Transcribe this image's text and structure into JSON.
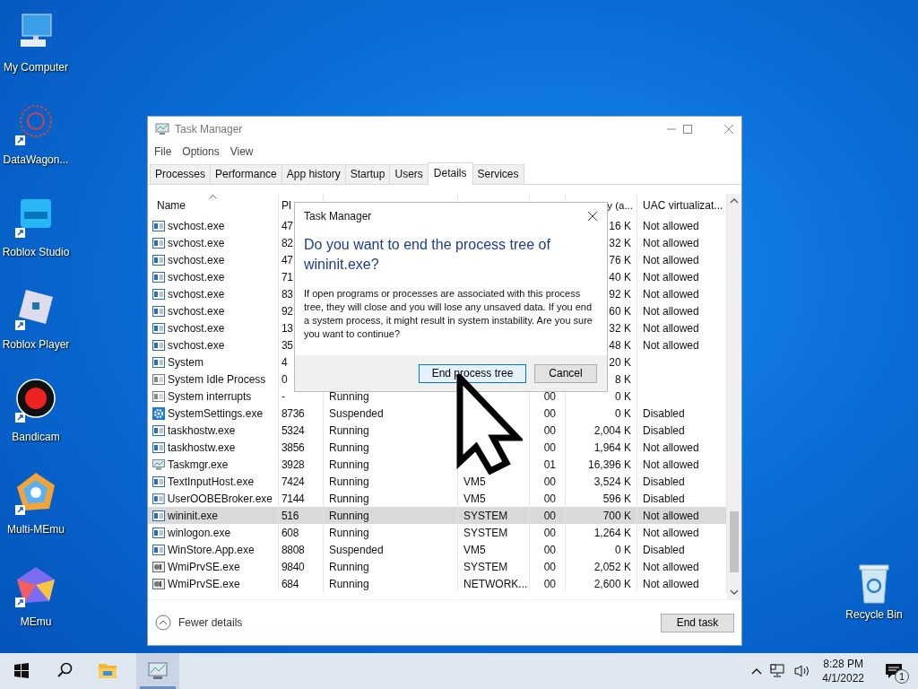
{
  "desktop_icons": [
    {
      "label": "My Computer",
      "kind": "computer",
      "shortcut": false
    },
    {
      "label": "DataWagon...",
      "kind": "web",
      "shortcut": true
    },
    {
      "label": "Roblox Studio",
      "kind": "studio",
      "shortcut": true
    },
    {
      "label": "Roblox Player",
      "kind": "player",
      "shortcut": true
    },
    {
      "label": "Bandicam",
      "kind": "record",
      "shortcut": true
    },
    {
      "label": "Multi-MEmu",
      "kind": "memu-multi",
      "shortcut": true
    },
    {
      "label": "MEmu",
      "kind": "memu",
      "shortcut": true
    }
  ],
  "recycle_bin": {
    "label": "Recycle Bin"
  },
  "window": {
    "title": "Task Manager",
    "menu": [
      "File",
      "Options",
      "View"
    ],
    "tabs": [
      {
        "label": "Processes",
        "selected": false
      },
      {
        "label": "Performance",
        "selected": false
      },
      {
        "label": "App history",
        "selected": false
      },
      {
        "label": "Startup",
        "selected": false
      },
      {
        "label": "Users",
        "selected": false
      },
      {
        "label": "Details",
        "selected": true
      },
      {
        "label": "Services",
        "selected": false
      }
    ],
    "headers": {
      "name": "Name",
      "pid": "PI",
      "memory": "y (a...",
      "uac": "UAC virtualizat..."
    },
    "rows": [
      {
        "kind": "service",
        "name": "svchost.exe",
        "pid": "47",
        "memory": "16 K",
        "uac": "Not allowed",
        "selected": false
      },
      {
        "kind": "service",
        "name": "svchost.exe",
        "pid": "82",
        "memory": "32 K",
        "uac": "Not allowed",
        "selected": false
      },
      {
        "kind": "service",
        "name": "svchost.exe",
        "pid": "47",
        "memory": "76 K",
        "uac": "Not allowed",
        "selected": false
      },
      {
        "kind": "service",
        "name": "svchost.exe",
        "pid": "71",
        "memory": "40 K",
        "uac": "Not allowed",
        "selected": false
      },
      {
        "kind": "service",
        "name": "svchost.exe",
        "pid": "83",
        "memory": "92 K",
        "uac": "Not allowed",
        "selected": false
      },
      {
        "kind": "service",
        "name": "svchost.exe",
        "pid": "92",
        "memory": "60 K",
        "uac": "Not allowed",
        "selected": false
      },
      {
        "kind": "service",
        "name": "svchost.exe",
        "pid": "13",
        "memory": "32 K",
        "uac": "Not allowed",
        "selected": false
      },
      {
        "kind": "service",
        "name": "svchost.exe",
        "pid": "35",
        "memory": "48 K",
        "uac": "Not allowed",
        "selected": false
      },
      {
        "kind": "service",
        "name": "System",
        "pid": "4",
        "memory": "20 K",
        "selected": false
      },
      {
        "kind": "system",
        "name": "System Idle Process",
        "pid": "0",
        "memory": "8 K",
        "selected": false
      },
      {
        "kind": "system",
        "name": "System interrupts",
        "pid": "-",
        "status": "Running",
        "cpu": "00",
        "memory": "0 K",
        "selected": false
      },
      {
        "kind": "gear",
        "name": "SystemSettings.exe",
        "pid": "8736",
        "status": "Suspended",
        "cpu": "00",
        "memory": "0 K",
        "uac": "Disabled",
        "selected": false
      },
      {
        "kind": "service",
        "name": "taskhostw.exe",
        "pid": "5324",
        "status": "Running",
        "cpu": "00",
        "memory": "2,004 K",
        "uac": "Disabled",
        "selected": false
      },
      {
        "kind": "service",
        "name": "taskhostw.exe",
        "pid": "3856",
        "status": "Running",
        "cpu": "00",
        "memory": "1,964 K",
        "uac": "Not allowed",
        "selected": false
      },
      {
        "kind": "monitor",
        "name": "Taskmgr.exe",
        "pid": "3928",
        "status": "Running",
        "cpu": "01",
        "memory": "16,396 K",
        "uac": "Not allowed",
        "selected": false
      },
      {
        "kind": "service",
        "name": "TextInputHost.exe",
        "pid": "7424",
        "status": "Running",
        "user": "VM5",
        "cpu": "00",
        "memory": "3,524 K",
        "uac": "Disabled",
        "selected": false
      },
      {
        "kind": "service",
        "name": "UserOOBEBroker.exe",
        "pid": "7144",
        "status": "Running",
        "user": "VM5",
        "cpu": "00",
        "memory": "596 K",
        "uac": "Disabled",
        "selected": false
      },
      {
        "kind": "service",
        "name": "wininit.exe",
        "pid": "516",
        "status": "Running",
        "user": "SYSTEM",
        "cpu": "00",
        "memory": "700 K",
        "uac": "Not allowed",
        "selected": true
      },
      {
        "kind": "service",
        "name": "winlogon.exe",
        "pid": "608",
        "status": "Running",
        "user": "SYSTEM",
        "cpu": "00",
        "memory": "1,264 K",
        "uac": "Not allowed",
        "selected": false
      },
      {
        "kind": "service",
        "name": "WinStore.App.exe",
        "pid": "8808",
        "status": "Suspended",
        "user": "VM5",
        "cpu": "00",
        "memory": "0 K",
        "uac": "Disabled",
        "selected": false
      },
      {
        "kind": "tool",
        "name": "WmiPrvSE.exe",
        "pid": "9840",
        "status": "Running",
        "user": "SYSTEM",
        "cpu": "00",
        "memory": "2,052 K",
        "uac": "Not allowed",
        "selected": false
      },
      {
        "kind": "tool",
        "name": "WmiPrvSE.exe",
        "pid": "684",
        "status": "Running",
        "user": "NETWORK...",
        "cpu": "00",
        "memory": "2,600 K",
        "uac": "Not allowed",
        "selected": false
      }
    ],
    "fewer_details": "Fewer details",
    "end_task": "End task"
  },
  "dialog": {
    "title": "Task Manager",
    "heading": "Do you want to end the process tree of wininit.exe?",
    "message": "If open programs or processes are associated with this process tree, they will close and you will lose any unsaved data. If you end a system process, it might result in system instability. Are you sure you want to continue?",
    "buttons": [
      {
        "label": "End process tree",
        "default": true
      },
      {
        "label": "Cancel",
        "default": false
      }
    ]
  },
  "taskbar": {
    "time": "8:28 PM",
    "date": "4/1/2022",
    "notifications": "1"
  }
}
